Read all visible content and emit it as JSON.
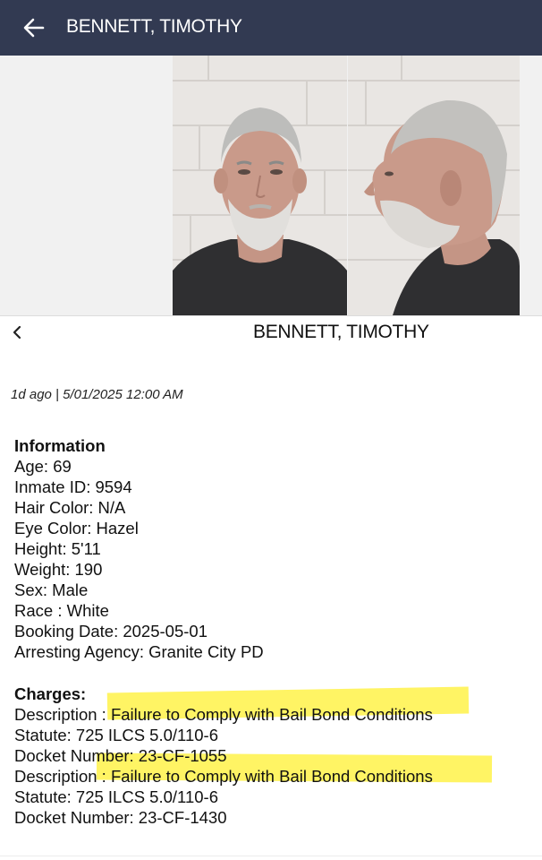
{
  "appbar": {
    "title": "BENNETT, TIMOTHY",
    "back_icon": "arrow-left-icon",
    "background": "#323a52"
  },
  "detail": {
    "title": "BENNETT, TIMOTHY",
    "back_icon": "chevron-left-icon",
    "meta": "1d ago | 5/01/2025 12:00 AM"
  },
  "information": {
    "heading": "Information",
    "lines": [
      "Age: 69",
      "Inmate ID: 9594",
      "Hair Color: N/A",
      "Eye Color: Hazel",
      "Height: 5'11",
      "Weight: 190",
      "Sex: Male",
      "Race : White",
      "Booking Date: 2025-05-01",
      "Arresting Agency: Granite City PD"
    ]
  },
  "charges": {
    "heading": "Charges:",
    "lines": [
      "Description : Failure to Comply with Bail Bond Conditions",
      "Statute: 725 ILCS 5.0/110-6",
      "Docket Number: 23-CF-1055",
      "Description : Failure to Comply with Bail Bond Conditions",
      "Statute: 725 ILCS 5.0/110-6",
      "Docket Number: 23-CF-1430"
    ],
    "highlight_color": "#fff028"
  }
}
